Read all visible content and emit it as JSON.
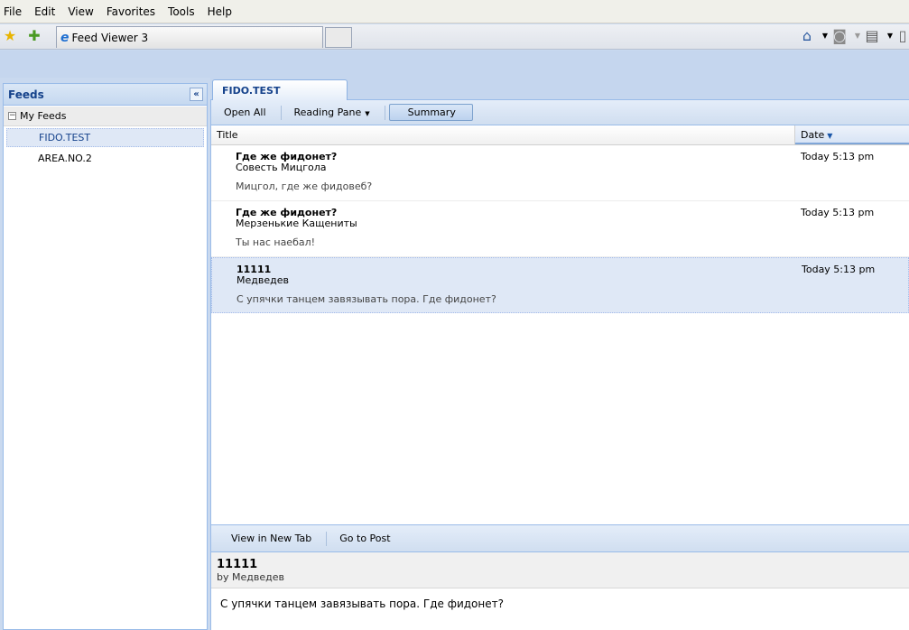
{
  "menu": [
    "File",
    "Edit",
    "View",
    "Favorites",
    "Tools",
    "Help"
  ],
  "browser": {
    "tab_title": "Feed Viewer 3",
    "icons": [
      "favorites-star-icon",
      "add-favorite-icon",
      "home-icon",
      "rss-feed-icon",
      "print-icon",
      "page-icon"
    ]
  },
  "feeds_panel": {
    "title": "Feeds",
    "collapse_glyph": "«",
    "root_label": "My Feeds",
    "items": [
      {
        "label": "FIDO.TEST",
        "selected": true
      },
      {
        "label": "AREA.NO.2",
        "selected": false
      }
    ]
  },
  "main": {
    "tab_label": "FIDO.TEST",
    "toolbar": {
      "open_all": "Open All",
      "reading_pane": "Reading Pane",
      "summary": "Summary"
    },
    "columns": {
      "title": "Title",
      "date": "Date"
    },
    "rows": [
      {
        "title": "Где же фидонет?",
        "author": "Совесть Мицгола",
        "summary": "Мицгол, где же фидовеб?",
        "date": "Today 5:13 pm"
      },
      {
        "title": "Где же фидонет?",
        "author": "Мерзенькие Кащениты",
        "summary": "Ты нас наебал!",
        "date": "Today 5:13 pm"
      },
      {
        "title": "11111",
        "author": "Медведев",
        "summary": "С упячки танцем завязывать пора. Где фидонет?",
        "date": "Today 5:13 pm"
      }
    ]
  },
  "reading_pane": {
    "view_in_new_tab": "View in New Tab",
    "go_to_post": "Go to Post",
    "title": "11111",
    "byline": "by Медведев",
    "body": "С упячки танцем завязывать пора. Где фидонет?"
  },
  "colors": {
    "accent": "#15428b",
    "selection": "#dfe8f6",
    "border": "#99bbe8"
  }
}
